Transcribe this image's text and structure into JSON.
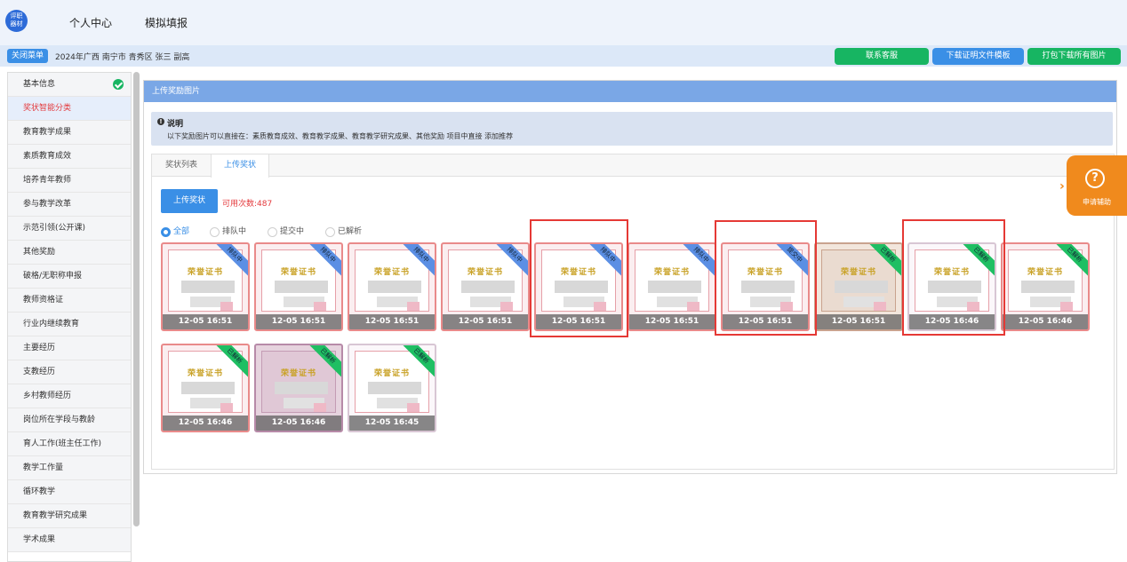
{
  "app": {
    "logo_text_1": "评职",
    "logo_text_2": "器材",
    "nav": [
      "个人中心",
      "模拟填报"
    ]
  },
  "subbar": {
    "close_menu": "关闭菜单",
    "breadcrumb": "2024年广西 南宁市 青秀区 张三 副高",
    "contact": "联系客服",
    "download_template": "下载证明文件模板",
    "download_all": "打包下载所有图片"
  },
  "sidebar": {
    "items": [
      "基本信息",
      "奖状智能分类",
      "教育教学成果",
      "素质教育成效",
      "培养青年教师",
      "参与教学改革",
      "示范引领(公开课)",
      "其他奖励",
      "破格/无职称申报",
      "教师资格证",
      "行业内继续教育",
      "主要经历",
      "支教经历",
      "乡村教师经历",
      "岗位所在学段与教龄",
      "育人工作(班主任工作)",
      "教学工作量",
      "循环教学",
      "教育教学研究成果",
      "学术成果"
    ]
  },
  "panel": {
    "title": "上传奖励图片",
    "notice_icon": "info-icon",
    "notice_title": "说明",
    "notice_text": "以下奖励图片可以直接在：素质教育成效、教育教学成果、教育教学研究成果、其他奖励 项目中直接 添加推荐",
    "tabs": [
      "奖状列表",
      "上传奖状"
    ],
    "upload_button": "上传奖状",
    "usable_count": "可用次数:487",
    "filters": [
      "全部",
      "排队中",
      "提交中",
      "已解析"
    ]
  },
  "certificates": [
    {
      "title": "荣誉证书",
      "time": "12-05 16:51",
      "status": "排队中"
    },
    {
      "title": "荣誉证书",
      "time": "12-05 16:51",
      "status": "排队中"
    },
    {
      "title": "荣誉证书",
      "time": "12-05 16:51",
      "status": "排队中"
    },
    {
      "title": "荣誉证书",
      "time": "12-05 16:51",
      "status": "排队中"
    },
    {
      "title": "荣誉证书",
      "time": "12-05 16:51",
      "status": "排队中"
    },
    {
      "title": "荣誉证书",
      "time": "12-05 16:51",
      "status": "排队中"
    },
    {
      "title": "荣誉证书",
      "time": "12-05 16:51",
      "status": "提交中"
    },
    {
      "title": "荣誉证书",
      "time": "12-05 16:51",
      "status": "已解析"
    },
    {
      "title": "荣誉证书",
      "time": "12-05 16:46",
      "status": "已解析"
    },
    {
      "title": "荣誉证书",
      "time": "12-05 16:46",
      "status": "已解析"
    },
    {
      "title": "荣誉证书",
      "time": "12-05 16:46",
      "status": "已解析"
    },
    {
      "title": "荣誉证书",
      "time": "12-05 16:46",
      "status": "已解析"
    },
    {
      "title": "荣誉证书",
      "time": "12-05 16:45",
      "status": "已解析"
    }
  ],
  "assist": {
    "icon": "question-icon",
    "label": "申请辅助"
  },
  "colors": {
    "primary": "#3a8fe6",
    "green": "#17b562",
    "red": "#e4393c",
    "orange": "#f08a1d"
  }
}
